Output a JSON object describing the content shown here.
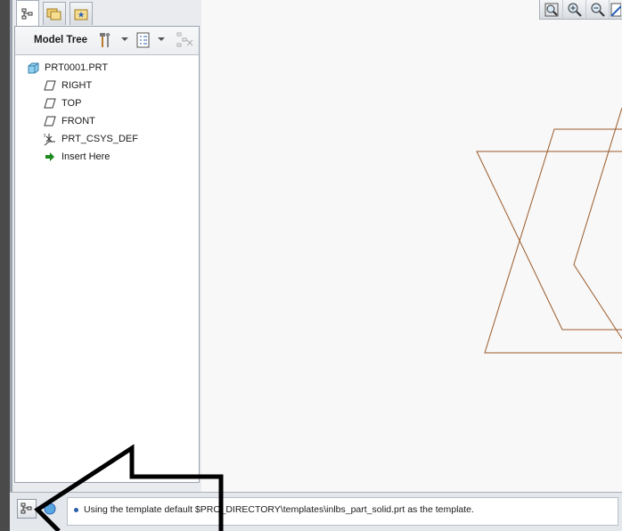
{
  "model_tree": {
    "title": "Model Tree",
    "items": [
      {
        "label": "PRT0001.PRT",
        "icon": "part-icon"
      },
      {
        "label": "RIGHT",
        "icon": "datum-plane-icon"
      },
      {
        "label": "TOP",
        "icon": "datum-plane-icon"
      },
      {
        "label": "FRONT",
        "icon": "datum-plane-icon"
      },
      {
        "label": "PRT_CSYS_DEF",
        "icon": "coordinate-system-icon"
      },
      {
        "label": "Insert Here",
        "icon": "insert-arrow-icon"
      }
    ]
  },
  "tabs": [
    "model-tree-tab",
    "folder-browser-tab",
    "favorites-tab"
  ],
  "view_toolbar": [
    "refit-icon",
    "zoom-in-icon",
    "zoom-out-icon",
    "repaint-icon"
  ],
  "status": {
    "message": "Using the template default $PRO_DIRECTORY\\templates\\inlbs_part_solid.prt as the template."
  },
  "colors": {
    "datum_plane_edge": "#9a5a2a",
    "insert_arrow": "#1f8a1f",
    "message_bullet": "#2b5ea8"
  }
}
